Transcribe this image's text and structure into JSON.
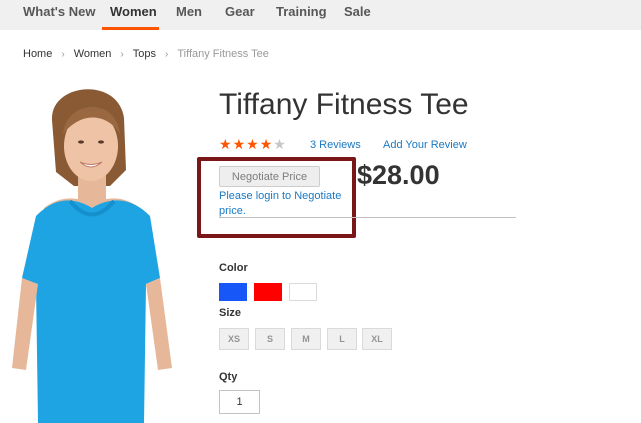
{
  "nav": {
    "items": [
      {
        "label": "What's New"
      },
      {
        "label": "Women"
      },
      {
        "label": "Men"
      },
      {
        "label": "Gear"
      },
      {
        "label": "Training"
      },
      {
        "label": "Sale"
      }
    ],
    "active": "Women",
    "accent_color": "#ff5501"
  },
  "breadcrumb": {
    "items": [
      "Home",
      "Women",
      "Tops"
    ],
    "current": "Tiffany Fitness Tee"
  },
  "product": {
    "name": "Tiffany Fitness Tee",
    "rating": 3.5,
    "rating_max": 5,
    "reviews_label": "3 Reviews",
    "add_review_label": "Add Your Review",
    "negotiate_button": "Negotiate Price",
    "login_note": "Please login to Negotiate price.",
    "price": "$28.00",
    "shirt_color": "#1ea3e3"
  },
  "options": {
    "color_label": "Color",
    "colors": [
      {
        "name": "blue",
        "hex": "#1857f7"
      },
      {
        "name": "red",
        "hex": "#ff0000"
      },
      {
        "name": "white",
        "hex": "#ffffff"
      }
    ],
    "size_label": "Size",
    "sizes": [
      "XS",
      "S",
      "M",
      "L",
      "XL"
    ],
    "qty_label": "Qty",
    "qty_value": "1"
  },
  "annotation": {
    "color": "#7b1618"
  }
}
